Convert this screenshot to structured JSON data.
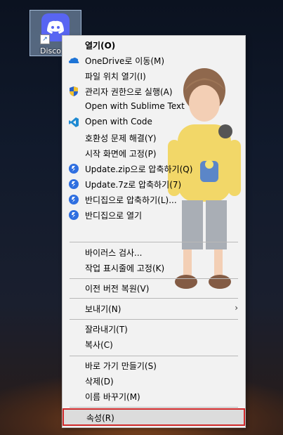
{
  "desktop": {
    "icon_label": "Disco",
    "shortcut_symbol": "↗"
  },
  "menu": {
    "items": [
      {
        "label": "열기(O)",
        "icon": "",
        "bold": true
      },
      {
        "label": "OneDrive로 이동(M)",
        "icon": "cloud-icon"
      },
      {
        "label": "파일 위치 열기(I)",
        "icon": ""
      },
      {
        "label": "관리자 권한으로 실행(A)",
        "icon": "uac-shield-icon"
      },
      {
        "label": "Open with Sublime Text",
        "icon": ""
      },
      {
        "label": "Open with Code",
        "icon": "vscode-icon"
      },
      {
        "label": "호환성 문제 해결(Y)",
        "icon": ""
      },
      {
        "label": "시작 화면에 고정(P)",
        "icon": ""
      },
      {
        "label": "Update.zip으로 압축하기(Q)",
        "icon": "bandizip-icon"
      },
      {
        "label": "Update.7z로 압축하기(7)",
        "icon": "bandizip-icon"
      },
      {
        "label": "반디집으로 압축하기(L)...",
        "icon": "bandizip-icon"
      },
      {
        "label": "반디집으로 열기",
        "icon": "bandizip-icon"
      },
      {
        "label": "바이러스 검사...",
        "icon": ""
      },
      {
        "label": "작업 표시줄에 고정(K)",
        "icon": ""
      },
      {
        "label": "이전 버전 복원(V)",
        "icon": ""
      },
      {
        "label": "보내기(N)",
        "icon": "",
        "submenu": true
      },
      {
        "label": "잘라내기(T)",
        "icon": ""
      },
      {
        "label": "복사(C)",
        "icon": ""
      },
      {
        "label": "바로 가기 만들기(S)",
        "icon": ""
      },
      {
        "label": "삭제(D)",
        "icon": ""
      },
      {
        "label": "이름 바꾸기(M)",
        "icon": ""
      },
      {
        "label": "속성(R)",
        "icon": "",
        "highlighted": true
      }
    ]
  },
  "colors": {
    "discord": "#5865f2",
    "onedrive": "#1e74d6",
    "bandizip": "#2f6fe0",
    "highlight_border": "#d0292a"
  }
}
